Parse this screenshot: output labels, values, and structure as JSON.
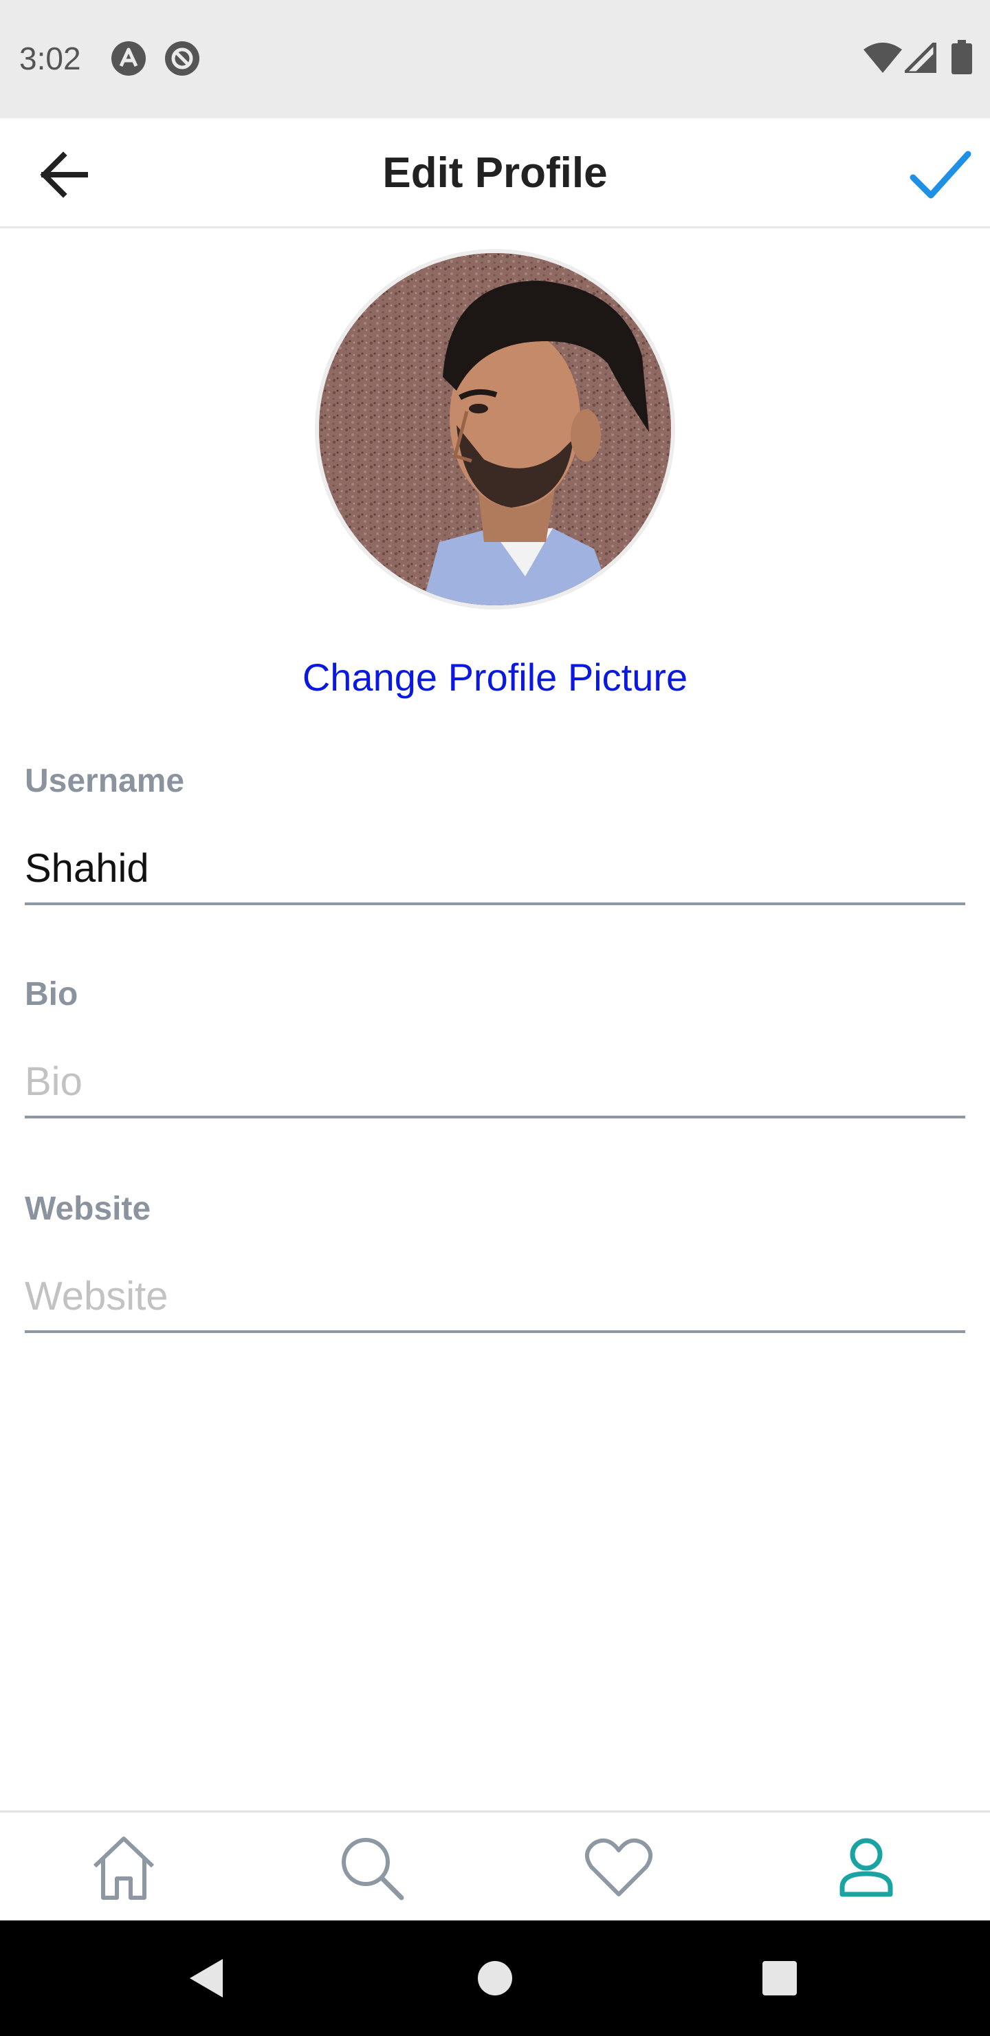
{
  "status_bar": {
    "time": "3:02",
    "icons": [
      "app-notification-icon",
      "at-sign-icon",
      "wifi-icon",
      "cell-signal-icon",
      "battery-icon"
    ]
  },
  "header": {
    "title": "Edit Profile",
    "back_icon": "arrow-left-icon",
    "confirm_icon": "checkmark-icon",
    "accent_color": "#1e90e6"
  },
  "profile": {
    "change_picture_label": "Change Profile Picture",
    "link_color": "#0b18e0"
  },
  "form": {
    "username": {
      "label": "Username",
      "value": "Shahid",
      "placeholder": ""
    },
    "bio": {
      "label": "Bio",
      "value": "",
      "placeholder": "Bio"
    },
    "website": {
      "label": "Website",
      "value": "",
      "placeholder": "Website"
    }
  },
  "bottom_nav": {
    "items": [
      {
        "icon": "home-icon",
        "active": false
      },
      {
        "icon": "search-icon",
        "active": false
      },
      {
        "icon": "heart-icon",
        "active": false
      },
      {
        "icon": "profile-icon",
        "active": true
      }
    ],
    "active_color": "#1aa3a3",
    "inactive_color": "#8d98a3"
  },
  "system_nav": {
    "icons": [
      "back-triangle-icon",
      "home-circle-icon",
      "recents-square-icon"
    ]
  }
}
